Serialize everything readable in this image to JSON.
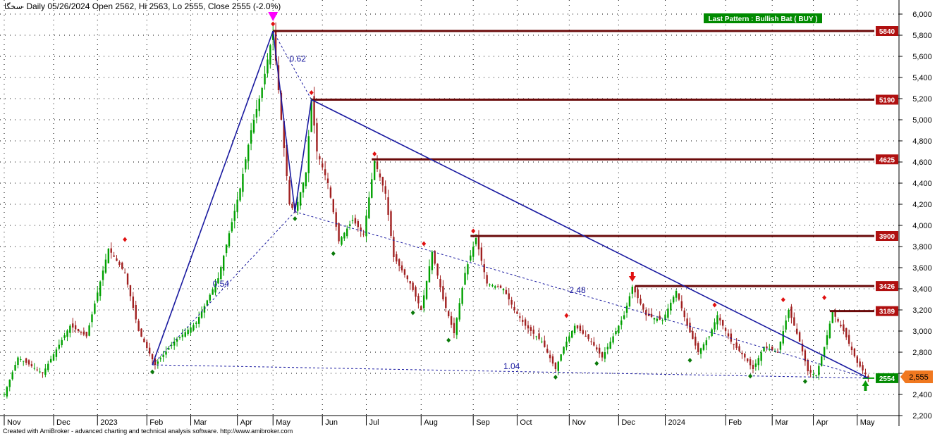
{
  "header": {
    "symbol": "سخگا",
    "info": "- Daily 05/26/2024 Open 2562, Hi 2563, Lo 2555, Close 2555 (-2.0%)"
  },
  "footer": "Created with AmiBroker - advanced charting and technical analysis software. http://www.amibroker.com",
  "pattern_badge": "Last Pattern : Bullish Bat ( BUY )",
  "last_price": "2,555",
  "colors": {
    "up": "#00a000",
    "down": "#a02020",
    "pattern_line": "#1a1aa0",
    "level_line": "#6a0a0a",
    "level_tag": "#b01010",
    "badge_bg": "#008a00",
    "price_tag": "#f07820"
  },
  "chart_data": {
    "type": "candlestick",
    "y_axis": {
      "ylim": [
        2200,
        6100
      ],
      "ticks": [
        "2,200",
        "2,400",
        "2,600",
        "2,800",
        "3,000",
        "3,200",
        "3,400",
        "3,600",
        "3,800",
        "4,000",
        "4,200",
        "4,400",
        "4,600",
        "4,800",
        "5,000",
        "5,200",
        "5,400",
        "5,600",
        "5,800",
        "6,000"
      ]
    },
    "x_axis": {
      "labels": [
        {
          "label": "Nov",
          "i": 0
        },
        {
          "label": "Dec",
          "i": 18
        },
        {
          "label": "2023",
          "i": 34
        },
        {
          "label": "Feb",
          "i": 52
        },
        {
          "label": "Mar",
          "i": 68
        },
        {
          "label": "Apr",
          "i": 85
        },
        {
          "label": "May",
          "i": 98
        },
        {
          "label": "Jun",
          "i": 116
        },
        {
          "label": "Jul",
          "i": 132
        },
        {
          "label": "Aug",
          "i": 152
        },
        {
          "label": "Sep",
          "i": 171
        },
        {
          "label": "Oct",
          "i": 187
        },
        {
          "label": "Nov",
          "i": 206
        },
        {
          "label": "Dec",
          "i": 224
        },
        {
          "label": "2024",
          "i": 241
        },
        {
          "label": "Feb",
          "i": 263
        },
        {
          "label": "Mar",
          "i": 280
        },
        {
          "label": "Apr",
          "i": 295
        },
        {
          "label": "May",
          "i": 311
        }
      ]
    },
    "anchors": [
      {
        "i": 0,
        "v": 2400
      },
      {
        "i": 5,
        "v": 2750
      },
      {
        "i": 14,
        "v": 2600
      },
      {
        "i": 24,
        "v": 3050
      },
      {
        "i": 30,
        "v": 2950
      },
      {
        "i": 38,
        "v": 3780
      },
      {
        "i": 44,
        "v": 3550
      },
      {
        "i": 49,
        "v": 3000
      },
      {
        "i": 55,
        "v": 2680
      },
      {
        "i": 62,
        "v": 2900
      },
      {
        "i": 70,
        "v": 3080
      },
      {
        "i": 78,
        "v": 3500
      },
      {
        "i": 86,
        "v": 4350
      },
      {
        "i": 90,
        "v": 4900
      },
      {
        "i": 94,
        "v": 5300
      },
      {
        "i": 98,
        "v": 5840
      },
      {
        "i": 101,
        "v": 5000
      },
      {
        "i": 104,
        "v": 4200
      },
      {
        "i": 106,
        "v": 4130
      },
      {
        "i": 110,
        "v": 4500
      },
      {
        "i": 112,
        "v": 5190
      },
      {
        "i": 114,
        "v": 4700
      },
      {
        "i": 118,
        "v": 4400
      },
      {
        "i": 122,
        "v": 3850
      },
      {
        "i": 127,
        "v": 4050
      },
      {
        "i": 131,
        "v": 3920
      },
      {
        "i": 135,
        "v": 4610
      },
      {
        "i": 139,
        "v": 4300
      },
      {
        "i": 142,
        "v": 3700
      },
      {
        "i": 148,
        "v": 3450
      },
      {
        "i": 152,
        "v": 3200
      },
      {
        "i": 156,
        "v": 3750
      },
      {
        "i": 160,
        "v": 3300
      },
      {
        "i": 164,
        "v": 2980
      },
      {
        "i": 168,
        "v": 3550
      },
      {
        "i": 172,
        "v": 3880
      },
      {
        "i": 176,
        "v": 3450
      },
      {
        "i": 182,
        "v": 3400
      },
      {
        "i": 186,
        "v": 3200
      },
      {
        "i": 190,
        "v": 3050
      },
      {
        "i": 196,
        "v": 2900
      },
      {
        "i": 201,
        "v": 2640
      },
      {
        "i": 204,
        "v": 2850
      },
      {
        "i": 208,
        "v": 3050
      },
      {
        "i": 214,
        "v": 2900
      },
      {
        "i": 218,
        "v": 2750
      },
      {
        "i": 221,
        "v": 2900
      },
      {
        "i": 226,
        "v": 3150
      },
      {
        "i": 229,
        "v": 3420
      },
      {
        "i": 234,
        "v": 3150
      },
      {
        "i": 240,
        "v": 3100
      },
      {
        "i": 245,
        "v": 3380
      },
      {
        "i": 249,
        "v": 3050
      },
      {
        "i": 253,
        "v": 2800
      },
      {
        "i": 257,
        "v": 2950
      },
      {
        "i": 260,
        "v": 3150
      },
      {
        "i": 265,
        "v": 2900
      },
      {
        "i": 270,
        "v": 2750
      },
      {
        "i": 273,
        "v": 2640
      },
      {
        "i": 277,
        "v": 2850
      },
      {
        "i": 282,
        "v": 2800
      },
      {
        "i": 286,
        "v": 3200
      },
      {
        "i": 290,
        "v": 2900
      },
      {
        "i": 293,
        "v": 2620
      },
      {
        "i": 296,
        "v": 2580
      },
      {
        "i": 299,
        "v": 2850
      },
      {
        "i": 302,
        "v": 3180
      },
      {
        "i": 306,
        "v": 3000
      },
      {
        "i": 311,
        "v": 2700
      },
      {
        "i": 315,
        "v": 2555
      }
    ],
    "pattern_lines": [
      {
        "from": {
          "i": 54,
          "v": 2680
        },
        "to": {
          "i": 98,
          "v": 5840
        },
        "style": "solid"
      },
      {
        "from": {
          "i": 98,
          "v": 5840
        },
        "to": {
          "i": 106,
          "v": 4130
        },
        "style": "solid"
      },
      {
        "from": {
          "i": 106,
          "v": 4130
        },
        "to": {
          "i": 112,
          "v": 5190
        },
        "style": "solid"
      },
      {
        "from": {
          "i": 112,
          "v": 5190
        },
        "to": {
          "i": 315,
          "v": 2555
        },
        "style": "solid"
      },
      {
        "from": {
          "i": 54,
          "v": 2680
        },
        "to": {
          "i": 106,
          "v": 4130
        },
        "style": "dashed"
      },
      {
        "from": {
          "i": 98,
          "v": 5840
        },
        "to": {
          "i": 112,
          "v": 5190
        },
        "style": "dashed"
      },
      {
        "from": {
          "i": 106,
          "v": 4130
        },
        "to": {
          "i": 315,
          "v": 2555
        },
        "style": "dashed"
      },
      {
        "from": {
          "i": 54,
          "v": 2680
        },
        "to": {
          "i": 315,
          "v": 2555
        },
        "style": "dashed"
      }
    ],
    "ratios": [
      {
        "label": "0.62",
        "i": 104,
        "v": 5550
      },
      {
        "label": "0.54",
        "i": 76,
        "v": 3420
      },
      {
        "label": "2.48",
        "i": 206,
        "v": 3360
      },
      {
        "label": "1.04",
        "i": 182,
        "v": 2640
      }
    ],
    "levels": [
      {
        "label": "5840",
        "v": 5840,
        "from_i": 98
      },
      {
        "label": "5190",
        "v": 5190,
        "from_i": 112
      },
      {
        "label": "4625",
        "v": 4625,
        "from_i": 134
      },
      {
        "label": "3900",
        "v": 3900,
        "from_i": 170
      },
      {
        "label": "3426",
        "v": 3426,
        "from_i": 230
      },
      {
        "label": "3189",
        "v": 3189,
        "from_i": 301
      },
      {
        "label": "2554",
        "v": 2554,
        "from_i": 313
      }
    ],
    "pivot_highs": [
      {
        "i": 44,
        "v": 3800
      },
      {
        "i": 98,
        "v": 5840
      },
      {
        "i": 112,
        "v": 5190
      },
      {
        "i": 135,
        "v": 4610
      },
      {
        "i": 153,
        "v": 3760
      },
      {
        "i": 171,
        "v": 3880
      },
      {
        "i": 205,
        "v": 3080
      },
      {
        "i": 259,
        "v": 3180
      },
      {
        "i": 284,
        "v": 3230
      },
      {
        "i": 299,
        "v": 3250
      }
    ],
    "pivot_lows": [
      {
        "i": 54,
        "v": 2680
      },
      {
        "i": 106,
        "v": 4130
      },
      {
        "i": 120,
        "v": 3800
      },
      {
        "i": 149,
        "v": 3240
      },
      {
        "i": 162,
        "v": 2980
      },
      {
        "i": 201,
        "v": 2630
      },
      {
        "i": 216,
        "v": 2760
      },
      {
        "i": 250,
        "v": 2790
      },
      {
        "i": 272,
        "v": 2640
      },
      {
        "i": 292,
        "v": 2590
      }
    ]
  }
}
